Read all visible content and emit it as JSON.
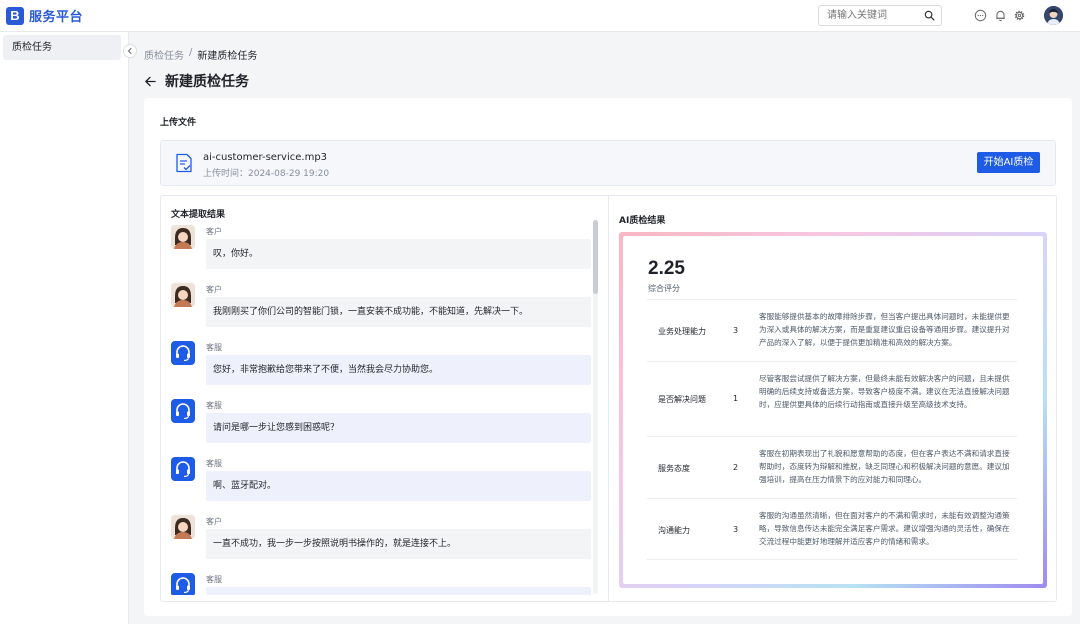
{
  "header": {
    "logo_letter": "B",
    "app_name": "服务平台",
    "search_placeholder": "请输入关键词"
  },
  "sidebar": {
    "items": [
      {
        "label": "质检任务"
      }
    ]
  },
  "breadcrumb": {
    "parent": "质检任务",
    "separator": "/",
    "current": "新建质检任务"
  },
  "page": {
    "title": "新建质检任务"
  },
  "upload": {
    "section_label": "上传文件",
    "file_name": "ai-customer-service.mp3",
    "upload_time": "上传时间：2024-08-29 19:20",
    "start_button": "开始AI质检"
  },
  "transcript": {
    "section_label": "文本提取结果",
    "messages": [
      {
        "role": "客户",
        "type": "customer",
        "text": "叹，你好。"
      },
      {
        "role": "客户",
        "type": "customer",
        "text": "我刚刚买了你们公司的智能门锁，一直安装不成功能，不能知道，先解决一下。"
      },
      {
        "role": "客服",
        "type": "agent",
        "text": "您好，非常抱歉给您带来了不便，当然我会尽力协助您。"
      },
      {
        "role": "客服",
        "type": "agent",
        "text": "请问是哪一步让您感到困惑呢？"
      },
      {
        "role": "客服",
        "type": "agent",
        "text": "啊、蓝牙配对。"
      },
      {
        "role": "客户",
        "type": "customer",
        "text": "一直不成功，我一步一步按照说明书操作的，就是连接不上。"
      },
      {
        "role": "客服",
        "type": "agent",
        "text": ""
      }
    ]
  },
  "ai_result": {
    "section_label": "AI质检结果",
    "score": "2.25",
    "score_label": "综合评分",
    "rows": [
      {
        "name": "业务处理能力",
        "score": "3",
        "desc": "客服能够提供基本的故障排除步骤，但当客户提出具体问题时，未能提供更为深入或具体的解决方案，而是重复建议重启设备等通用步骤。建议提升对产品的深入了解，以便于提供更加精准和高效的解决方案。"
      },
      {
        "name": "是否解决问题",
        "score": "1",
        "desc": "尽管客服尝试提供了解决方案，但最终未能有效解决客户的问题，且未提供明确的后续支持或备选方案，导致客户极度不满。建议在无法直接解决问题时，应提供更具体的后续行动指南或直接升级至高级技术支持。"
      },
      {
        "name": "服务态度",
        "score": "2",
        "desc": "客服在初期表现出了礼貌和愿意帮助的态度，但在客户表达不满和请求直接帮助时，态度转为辩解和推脱，缺乏同理心和积极解决问题的意愿。建议加强培训，提高在压力情景下的应对能力和同理心。"
      },
      {
        "name": "沟通能力",
        "score": "3",
        "desc": "客服的沟通虽然清晰，但在面对客户的不满和需求时，未能有效调整沟通策略，导致信息传达未能完全满足客户需求。建议增强沟通的灵活性，确保在交流过程中能更好地理解并适应客户的情绪和需求。"
      }
    ]
  },
  "colors": {
    "primary": "#1e5be6",
    "logo": "#2a5bd7"
  },
  "icons": [
    "search-icon",
    "message-icon",
    "bell-icon",
    "gear-icon",
    "chevron-left-icon",
    "back-arrow-icon",
    "document-icon",
    "headset-icon"
  ]
}
